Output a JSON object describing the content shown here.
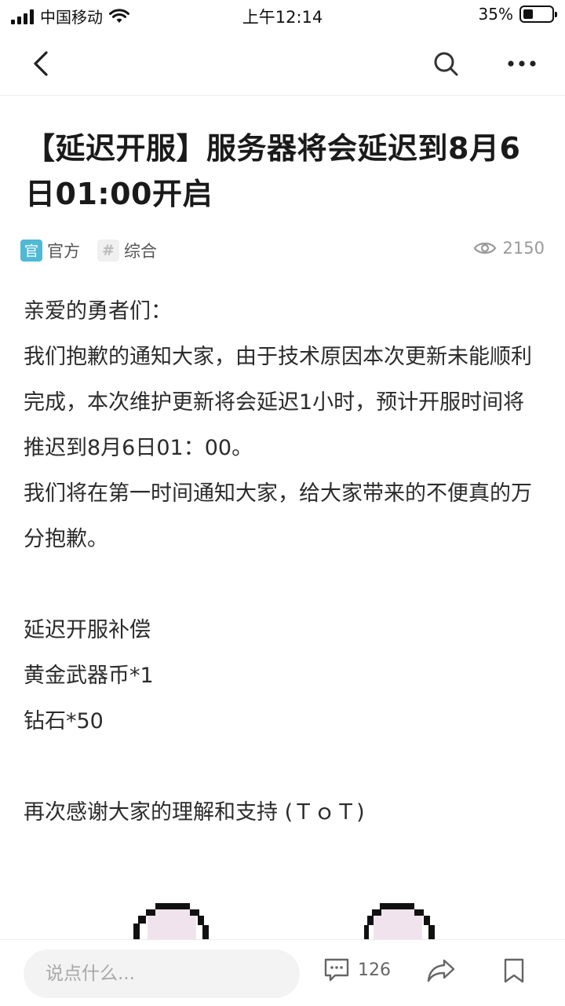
{
  "status_bar": {
    "carrier": "中国移动",
    "time": "上午12:14",
    "battery_percent": "35%",
    "battery_level": 0.35
  },
  "nav": {
    "back_icon": "chevron-left-icon",
    "search_icon": "search-icon",
    "more_icon": "more-dots-icon"
  },
  "post": {
    "title": "【延迟开服】服务器将会延迟到8月6日01:00开启",
    "badge_official": "官",
    "tag_official": "官方",
    "badge_general": "#",
    "tag_general": "综合",
    "views": "2150",
    "paragraphs": [
      "亲爱的勇者们：",
      "我们抱歉的通知大家，由于技术原因本次更新未能顺利完成，本次维护更新将会延迟1小时，预计开服时间将推迟到8月6日01：00。",
      "我们将在第一时间通知大家，给大家带来的不便真的万分抱歉。",
      "",
      "延迟开服补偿",
      "黄金武器币*1",
      "钻石*50",
      "",
      "再次感谢大家的理解和支持 (ＴｏＴ)"
    ]
  },
  "bottom_bar": {
    "comment_placeholder": "说点什么...",
    "comment_count": "126",
    "comment_icon": "comment-icon",
    "share_icon": "share-icon",
    "bookmark_icon": "bookmark-icon"
  },
  "colors": {
    "official_badge": "#4fb9d6",
    "text": "#2b2b2b",
    "muted": "#9a9a9a"
  }
}
